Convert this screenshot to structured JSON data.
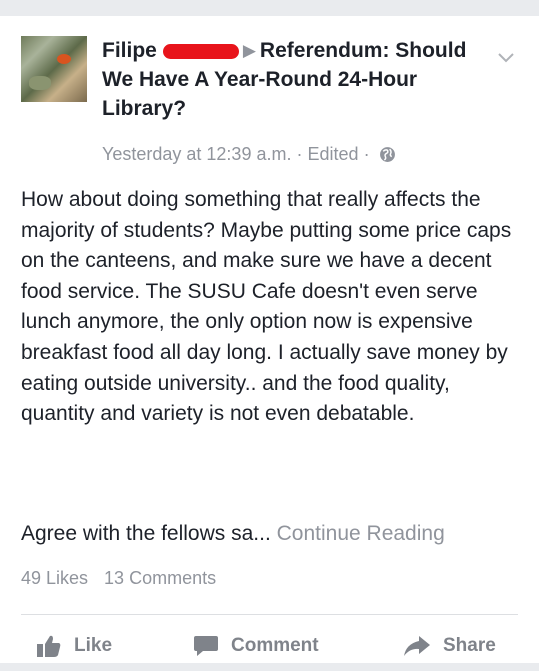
{
  "post": {
    "author": "Filipe",
    "target": "Referendum: Should We Have A Year-Round 24-Hour Library?",
    "timestamp": "Yesterday at 12:39 a.m.",
    "edited": "Edited",
    "separator": "·",
    "body": "How about doing something that really affects the majority of students? Maybe putting some price caps on the canteens, and make sure we have a decent food service. The SUSU Cafe doesn't even serve lunch anymore, the only option now is expensive breakfast food all day long. I actually save money by eating outside university.. and the food quality, quantity and variety is not even debatable.",
    "teaser": "Agree with the fellows sa...",
    "continue_label": "Continue Reading"
  },
  "stats": {
    "likes": "49 Likes",
    "comments": "13 Comments"
  },
  "actions": {
    "like": "Like",
    "comment": "Comment",
    "share": "Share"
  },
  "icons": {
    "avatar": "profile-photo",
    "arrow": "right-triangle-icon",
    "chevron": "chevron-down-icon",
    "globe": "globe-icon",
    "like": "thumbs-up-icon",
    "comment": "speech-bubble-icon",
    "share": "share-arrow-icon"
  },
  "colors": {
    "text": "#1d2129",
    "muted": "#90949c",
    "redaction": "#e8141b",
    "background": "#e9ebee"
  }
}
